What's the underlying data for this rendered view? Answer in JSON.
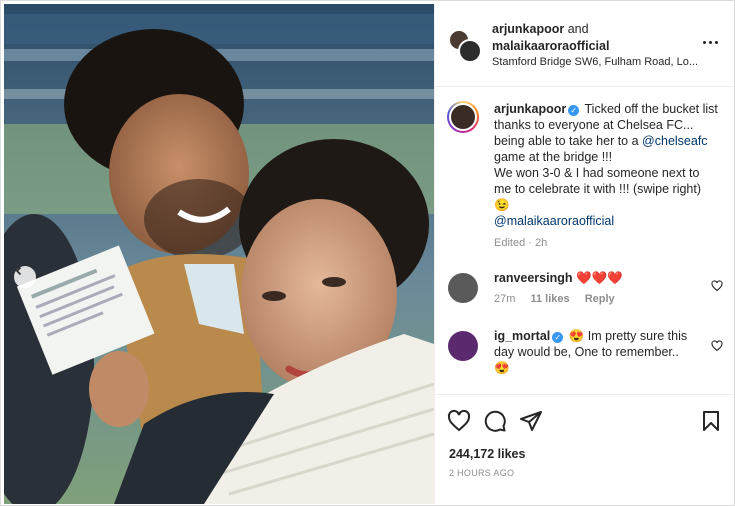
{
  "header": {
    "user1": "arjunkapoor",
    "and_text": "and",
    "user2": "malaikaaroraofficial",
    "location": "Stamford Bridge SW6, Fulham Road, Lo..."
  },
  "caption": {
    "username": "arjunkapoor",
    "text": "Ticked off the bucket list thanks to everyone at Chelsea FC... being able to take her to a",
    "mention1": "@chelseafc",
    "text2": "game at the bridge !!!",
    "text3": "We won 3-0 & I had someone next to me to celebrate it with !!! (swipe right)",
    "emoji": "😉",
    "mention2": "@malaikaaroraofficial",
    "meta": "Edited · 2h"
  },
  "comments": [
    {
      "username": "ranveersingh",
      "text": "❤️❤️❤️",
      "time": "27m",
      "likes": "11 likes",
      "reply": "Reply"
    },
    {
      "username": "ig_mortal",
      "text": "😍 Im pretty sure this day would be, One to remember..",
      "emoji2": "😍"
    }
  ],
  "actions": {
    "likes": "244,172 likes",
    "time": "2 HOURS AGO"
  },
  "icons": {
    "more": "more-options-icon",
    "like": "heart-icon",
    "comment": "comment-icon",
    "share": "paper-plane-icon",
    "save": "bookmark-icon",
    "prev": "chevron-left-icon",
    "verified": "verified-badge-icon"
  },
  "colors": {
    "verified": "#3897f0",
    "link": "#00376b",
    "muted": "#8e8e8e",
    "heart": "#e0245e"
  }
}
